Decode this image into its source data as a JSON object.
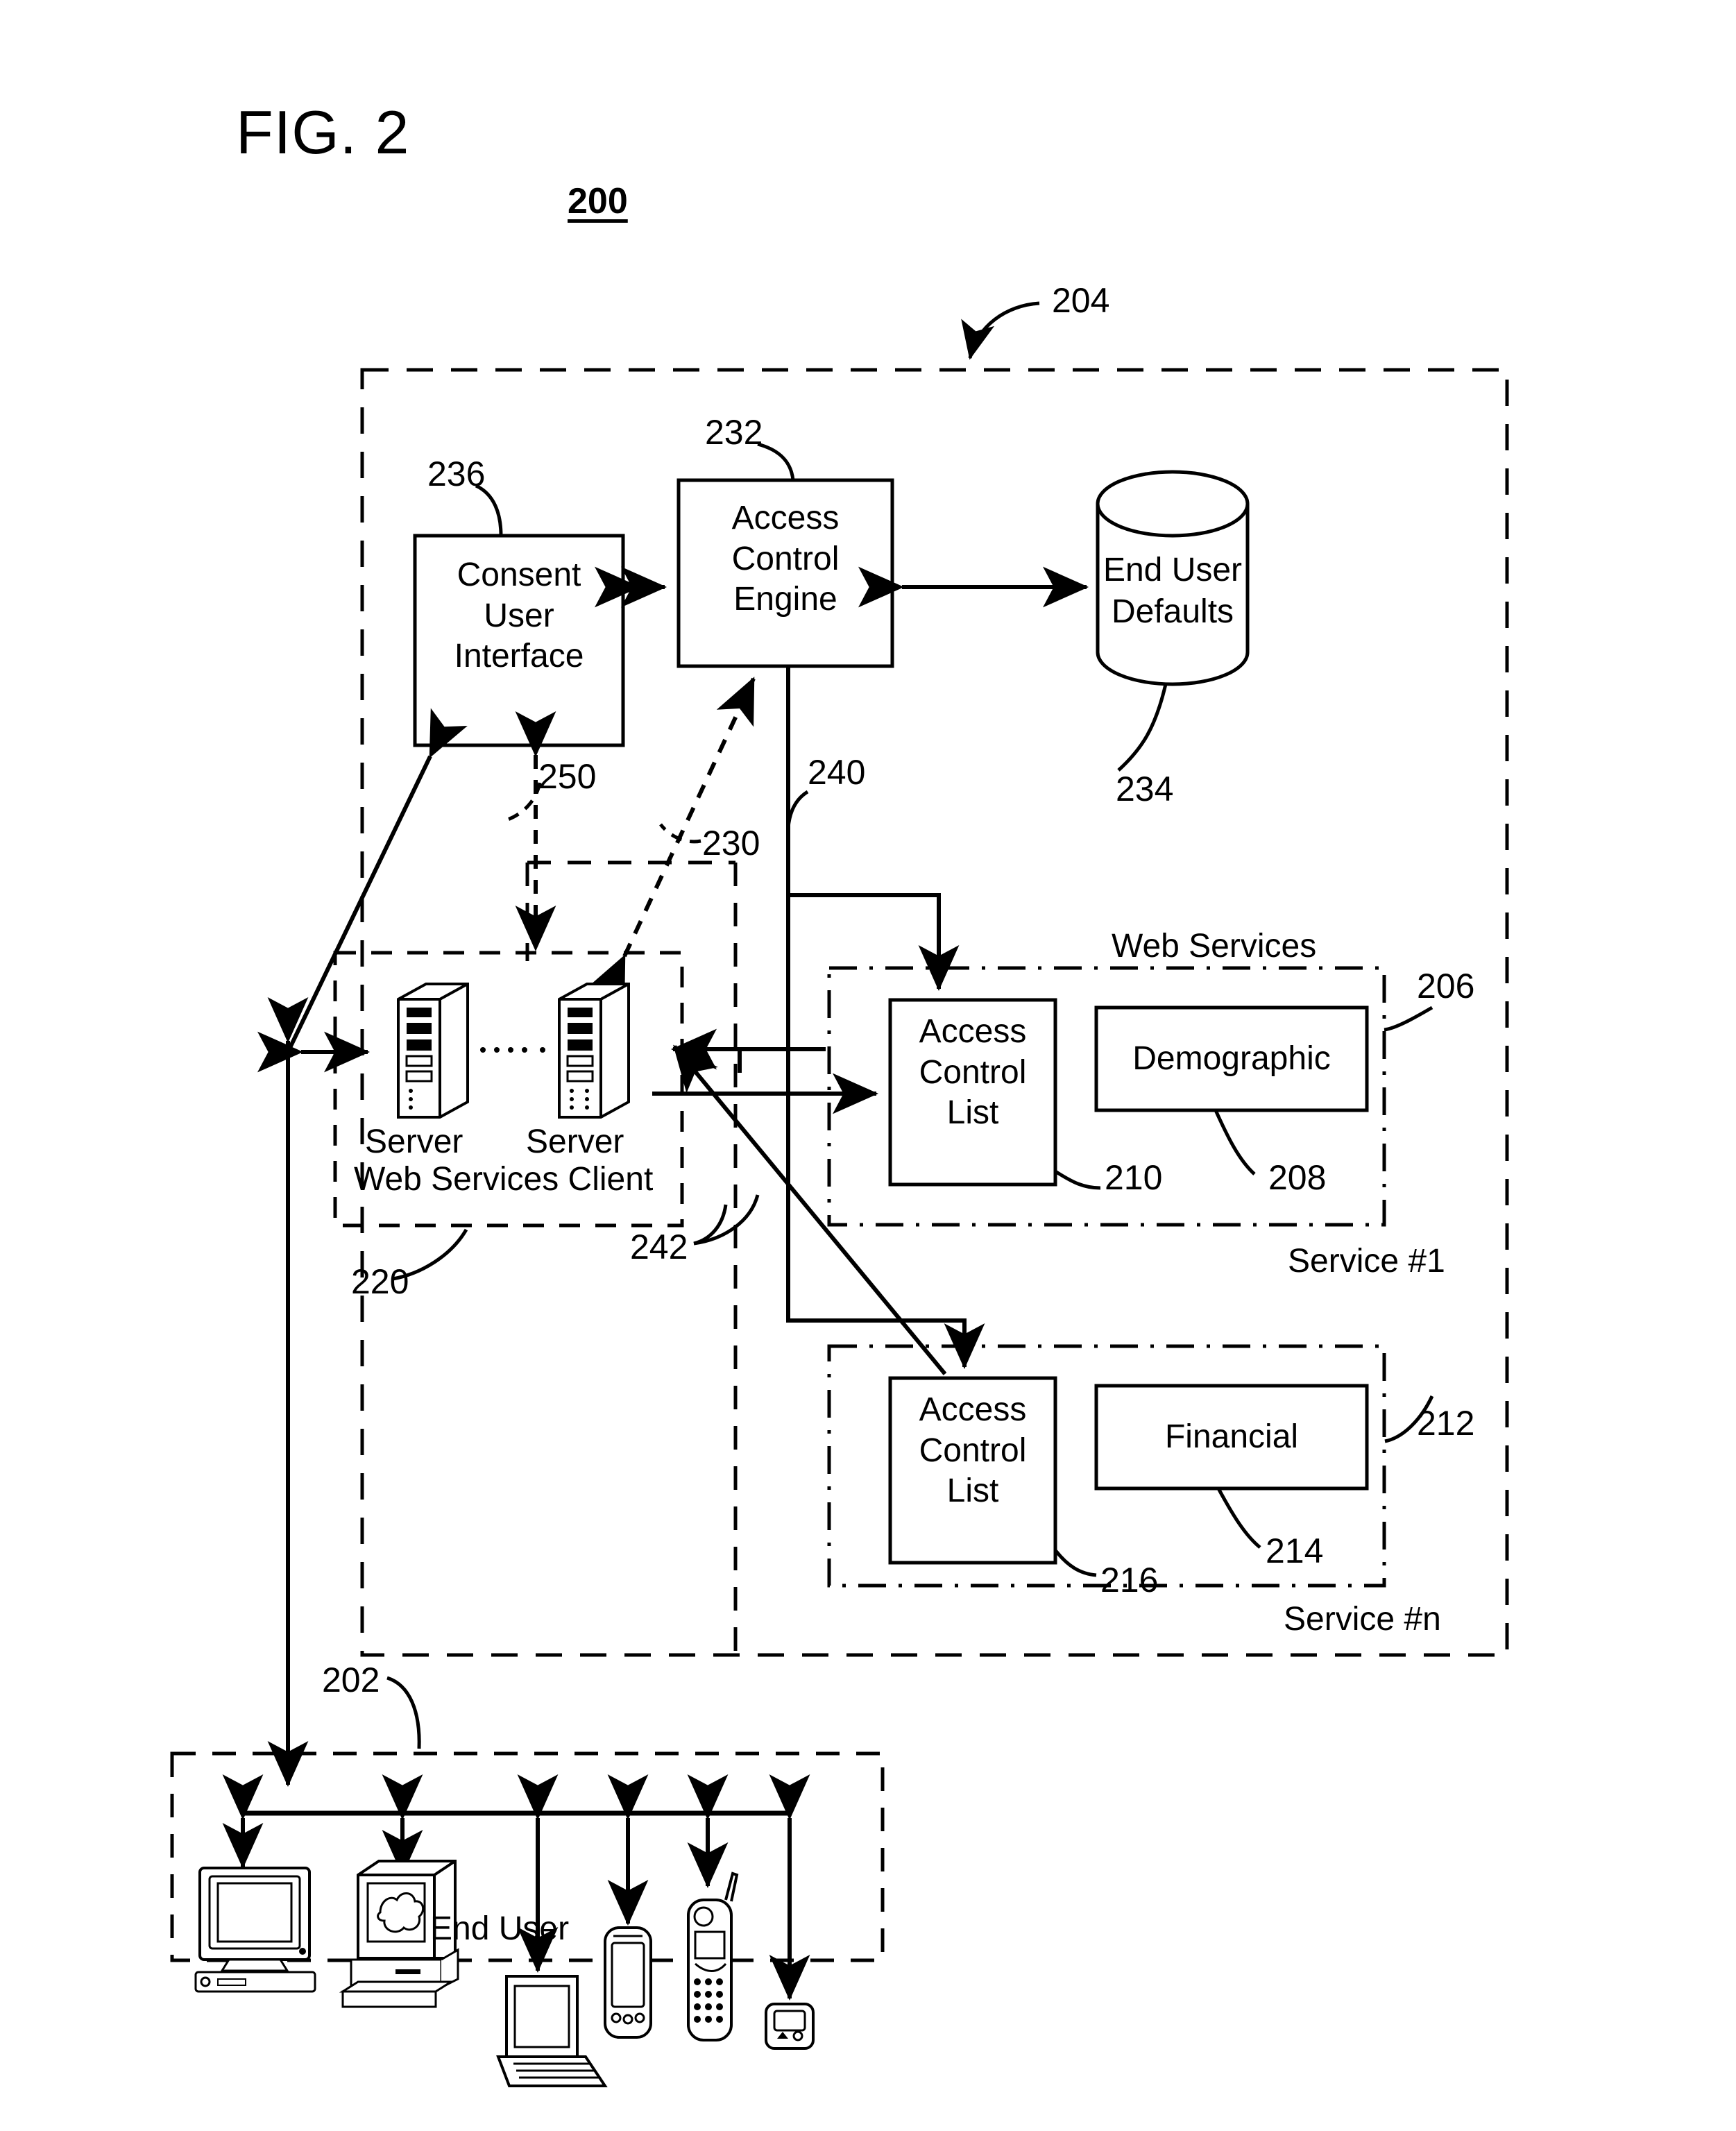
{
  "figure": {
    "title": "FIG. 2",
    "number": "200"
  },
  "reference_numerals": {
    "system": "204",
    "end_user_domain": "202",
    "web_services_client": "220",
    "client_boundary": "230",
    "access_control_engine": "232",
    "end_user_defaults": "234",
    "consent_user_interface": "236",
    "engine_to_acl_path": "240",
    "client_to_acl_path": "242",
    "consent_ui_path": "250",
    "service1": "206",
    "demographic": "208",
    "acl_service1": "210",
    "servicen": "212",
    "financial": "214",
    "acl_servicen": "216"
  },
  "blocks": {
    "consent_user_interface": "Consent\nUser\nInterface",
    "access_control_engine": "Access\nControl\nEngine",
    "end_user_defaults": "End User\nDefaults",
    "acl_service1": "Access\nControl\nList",
    "demographic": "Demographic",
    "acl_servicen": "Access\nControl\nList",
    "financial": "Financial"
  },
  "group_labels": {
    "web_services": "Web Services",
    "service_1": "Service #1",
    "service_n": "Service #n",
    "web_services_client": "Web Services Client",
    "end_user": "End User",
    "server_left": "Server",
    "server_right": "Server",
    "server_ellipsis": ". . . . .   . ."
  },
  "end_user_devices": [
    "desktop-computer-icon",
    "workstation-computer-icon",
    "laptop-computer-icon",
    "pda-icon",
    "mobile-phone-icon",
    "pager-icon"
  ],
  "colors": {
    "ink": "#000000",
    "paper": "#ffffff"
  }
}
